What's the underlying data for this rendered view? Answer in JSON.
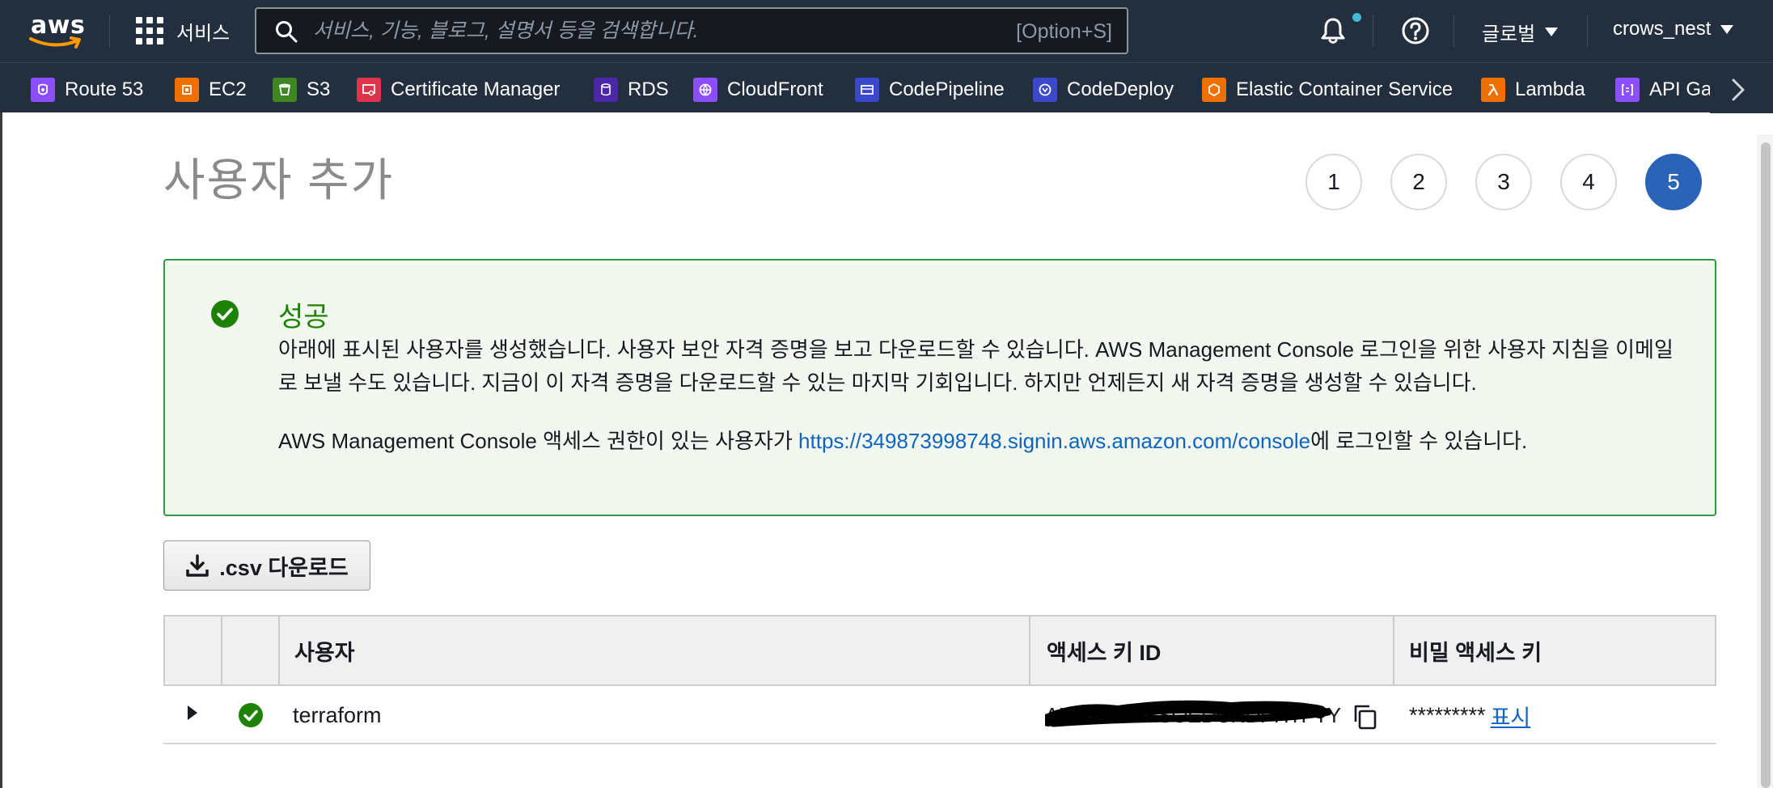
{
  "nav": {
    "logo_text": "aws",
    "services_label": "서비스",
    "search_placeholder": "서비스, 기능, 블로그, 설명서 등을 검색합니다.",
    "search_shortcut": "[Option+S]",
    "region_label": "글로벌",
    "account_label": "crows_nest"
  },
  "favorites": [
    {
      "label": "Route 53",
      "icon": "route53-icon",
      "color": "#8c4fff"
    },
    {
      "label": "EC2",
      "icon": "ec2-icon",
      "color": "#ed7100"
    },
    {
      "label": "S3",
      "icon": "s3-icon",
      "color": "#3f8624"
    },
    {
      "label": "Certificate Manager",
      "icon": "certificate-manager-icon",
      "color": "#dd344c"
    },
    {
      "label": "RDS",
      "icon": "rds-icon",
      "color": "#4d27aa"
    },
    {
      "label": "CloudFront",
      "icon": "cloudfront-icon",
      "color": "#8c4fff"
    },
    {
      "label": "CodePipeline",
      "icon": "codepipeline-icon",
      "color": "#3b48cc"
    },
    {
      "label": "CodeDeploy",
      "icon": "codedeploy-icon",
      "color": "#3b48cc"
    },
    {
      "label": "Elastic Container Service",
      "icon": "ecs-icon",
      "color": "#ed7100"
    },
    {
      "label": "Lambda",
      "icon": "lambda-icon",
      "color": "#ed7100"
    },
    {
      "label": "API Gat",
      "icon": "api-gateway-icon",
      "color": "#8c4fff"
    }
  ],
  "page": {
    "title": "사용자 추가",
    "steps": [
      "1",
      "2",
      "3",
      "4",
      "5"
    ],
    "active_step": "5"
  },
  "alert": {
    "title": "성공",
    "body_line1": "아래에 표시된 사용자를 생성했습니다. 사용자 보안 자격 증명을 보고 다운로드할 수 있습니다. AWS Management Console 로그인을 위한 사용자 지침을 이메일로 보낼 수도 있습니다. 지금이 이 자격 증명을 다운로드할 수 있는 마지막 기회입니다. 하지만 언제든지 새 자격 증명을 생성할 수 있습니다.",
    "body_line2_prefix": "AWS Management Console 액세스 권한이 있는 사용자가 ",
    "body_link": "https://349873998748.signin.aws.amazon.com/console",
    "body_line2_suffix": "에 로그인할 수 있습니다."
  },
  "csv_button": ".csv 다운로드",
  "table": {
    "headers": {
      "user": "사용자",
      "access_key_id": "액세스 키 ID",
      "secret_key": "비밀 액세스 키"
    },
    "rows": [
      {
        "user": "terraform",
        "access_key_id": "AKIAVDEXFSOEDCNDPHTPTY",
        "secret_masked": "*********",
        "show_label": "표시"
      }
    ]
  },
  "colors": {
    "nav_bg": "#232f3e",
    "success_green": "#1d8102",
    "link_blue": "#0f64c0",
    "active_step": "#2a63b8"
  }
}
